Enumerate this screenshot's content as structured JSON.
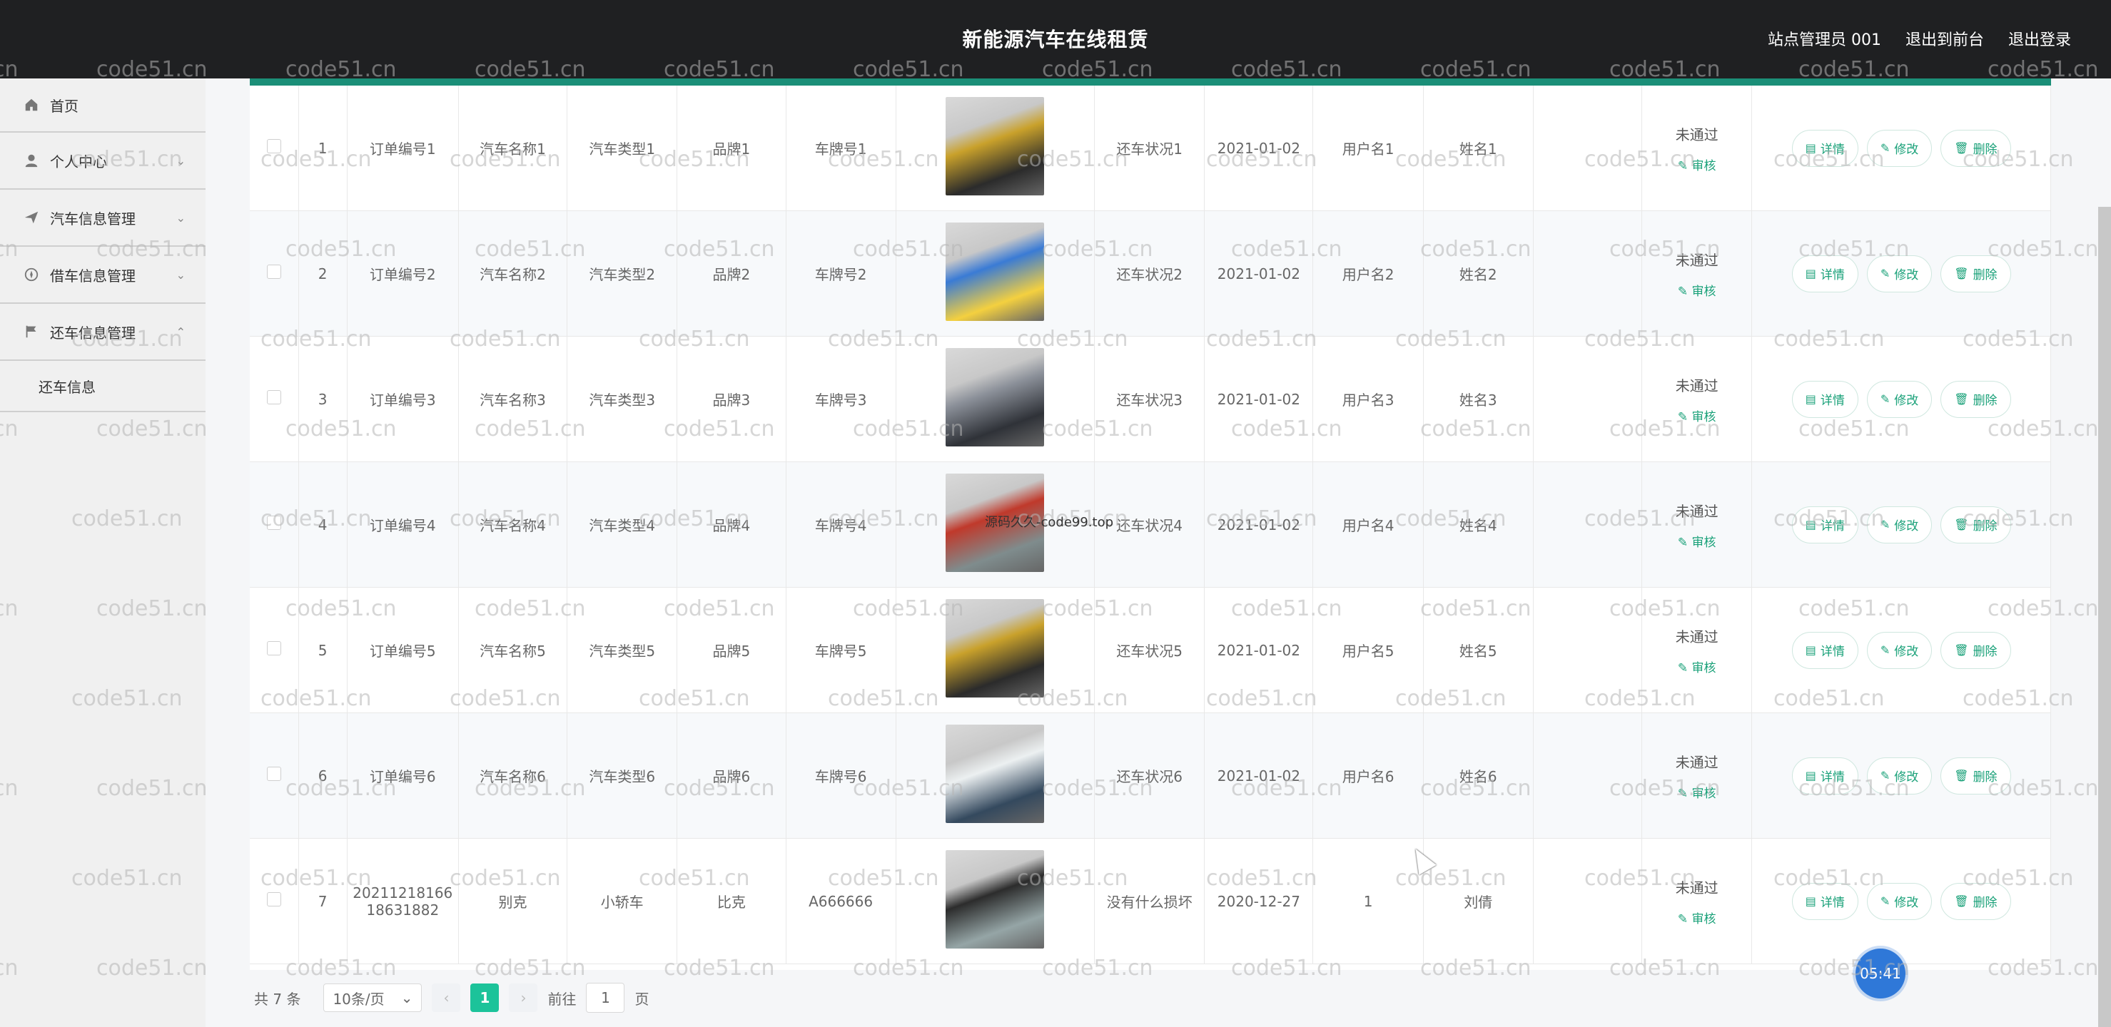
{
  "header": {
    "title": "新能源汽车在线租赁",
    "user_label": "站点管理员 001",
    "to_front_label": "退出到前台",
    "logout_label": "退出登录"
  },
  "sidebar": {
    "items": [
      {
        "label": "首页",
        "icon": "home-icon"
      },
      {
        "label": "个人中心",
        "icon": "user-icon"
      },
      {
        "label": "汽车信息管理",
        "icon": "send-icon"
      },
      {
        "label": "借车信息管理",
        "icon": "compass-icon"
      },
      {
        "label": "还车信息管理",
        "icon": "flag-icon"
      }
    ],
    "subitem": "还车信息"
  },
  "table": {
    "rows": [
      {
        "no": "1",
        "order": "订单编号1",
        "car_name": "汽车名称1",
        "car_type": "汽车类型1",
        "brand": "品牌1",
        "plate": "车牌号1",
        "condition": "还车状况1",
        "date": "2021-01-02",
        "username": "用户名1",
        "name": "姓名1",
        "status": "未通过",
        "review": "审核",
        "image_colors": [
          "#c9a12b",
          "#2b2b2b"
        ]
      },
      {
        "no": "2",
        "order": "订单编号2",
        "car_name": "汽车名称2",
        "car_type": "汽车类型2",
        "brand": "品牌2",
        "plate": "车牌号2",
        "condition": "还车状况2",
        "date": "2021-01-02",
        "username": "用户名2",
        "name": "姓名2",
        "status": "未通过",
        "review": "审核",
        "image_colors": [
          "#3a7bd5",
          "#f4d03f"
        ]
      },
      {
        "no": "3",
        "order": "订单编号3",
        "car_name": "汽车名称3",
        "car_type": "汽车类型3",
        "brand": "品牌3",
        "plate": "车牌号3",
        "condition": "还车状况3",
        "date": "2021-01-02",
        "username": "用户名3",
        "name": "姓名3",
        "status": "未通过",
        "review": "审核",
        "image_colors": [
          "#8b9099",
          "#2f3238"
        ]
      },
      {
        "no": "4",
        "order": "订单编号4",
        "car_name": "汽车名称4",
        "car_type": "汽车类型4",
        "brand": "品牌4",
        "plate": "车牌号4",
        "condition": "还车状况4",
        "date": "2021-01-02",
        "username": "用户名4",
        "name": "姓名4",
        "status": "未通过",
        "review": "审核",
        "image_colors": [
          "#c0392b",
          "#7f8c8d"
        ]
      },
      {
        "no": "5",
        "order": "订单编号5",
        "car_name": "汽车名称5",
        "car_type": "汽车类型5",
        "brand": "品牌5",
        "plate": "车牌号5",
        "condition": "还车状况5",
        "date": "2021-01-02",
        "username": "用户名5",
        "name": "姓名5",
        "status": "未通过",
        "review": "审核",
        "image_colors": [
          "#c9a12b",
          "#2b2b2b"
        ]
      },
      {
        "no": "6",
        "order": "订单编号6",
        "car_name": "汽车名称6",
        "car_type": "汽车类型6",
        "brand": "品牌6",
        "plate": "车牌号6",
        "condition": "还车状况6",
        "date": "2021-01-02",
        "username": "用户名6",
        "name": "姓名6",
        "status": "未通过",
        "review": "审核",
        "image_colors": [
          "#ecf0f1",
          "#34495e"
        ]
      },
      {
        "no": "7",
        "order": "20211218166 18631882",
        "car_name": "别克",
        "car_type": "小轿车",
        "brand": "比克",
        "plate": "A666666",
        "condition": "没有什么损坏",
        "date": "2020-12-27",
        "username": "1",
        "name": "刘倩",
        "status": "未通过",
        "review": "审核",
        "image_colors": [
          "#2c2c2c",
          "#95a5a6"
        ]
      }
    ],
    "actions": {
      "detail": "详情",
      "edit": "修改",
      "delete": "删除"
    }
  },
  "pagination": {
    "total": "共 7 条",
    "page_size": "10条/页",
    "current_page": "1",
    "goto_label": "前往",
    "goto_value": "1",
    "page_unit": "页"
  },
  "overlay": {
    "timer": "05:41",
    "watermark_text": "code51.cn",
    "center_watermark": "源码久久-code99.top"
  },
  "colors": {
    "accent": "#1b8f78",
    "topbar": "#1f2022",
    "action": "#1aa179",
    "pager_active": "#1cc39a"
  }
}
